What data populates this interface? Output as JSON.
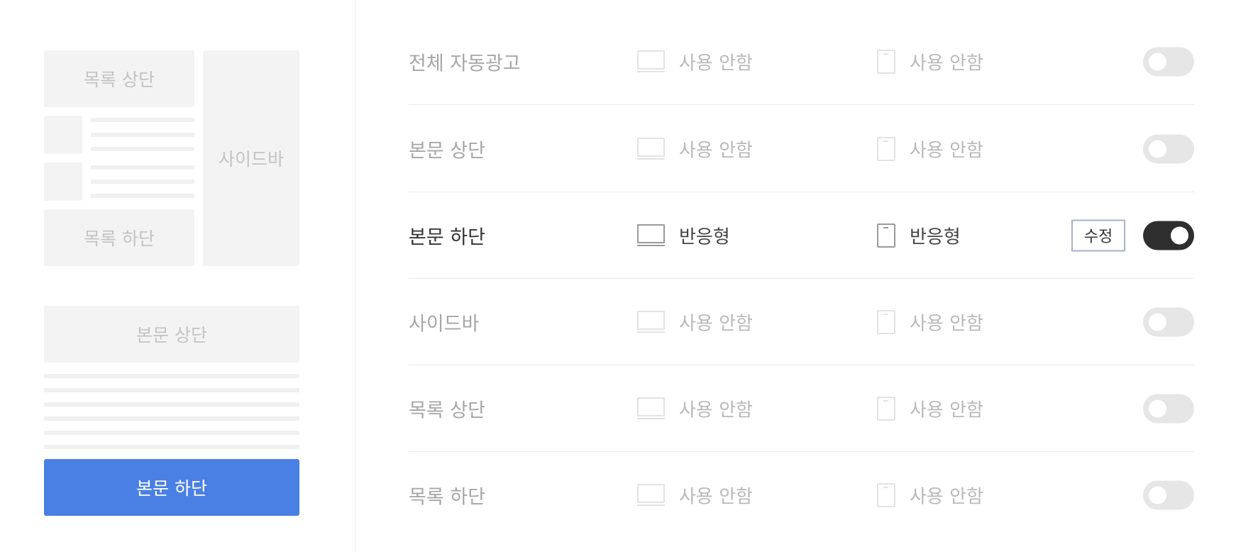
{
  "preview": {
    "list_top": "목록 상단",
    "list_bottom": "목록 하단",
    "sidebar": "사이드바",
    "body_top": "본문 상단",
    "body_bottom": "본문 하단"
  },
  "rows": [
    {
      "title": "전체 자동광고",
      "pc": "사용 안함",
      "mobile": "사용 안함",
      "enabled": false
    },
    {
      "title": "본문 상단",
      "pc": "사용 안함",
      "mobile": "사용 안함",
      "enabled": false
    },
    {
      "title": "본문 하단",
      "pc": "반응형",
      "mobile": "반응형",
      "enabled": true,
      "edit_label": "수정"
    },
    {
      "title": "사이드바",
      "pc": "사용 안함",
      "mobile": "사용 안함",
      "enabled": false
    },
    {
      "title": "목록 상단",
      "pc": "사용 안함",
      "mobile": "사용 안함",
      "enabled": false
    },
    {
      "title": "목록 하단",
      "pc": "사용 안함",
      "mobile": "사용 안함",
      "enabled": false
    }
  ],
  "colors": {
    "active_block": "#4a80e4",
    "toggle_on": "#2f2f2f",
    "toggle_off": "#e6e6e6"
  }
}
